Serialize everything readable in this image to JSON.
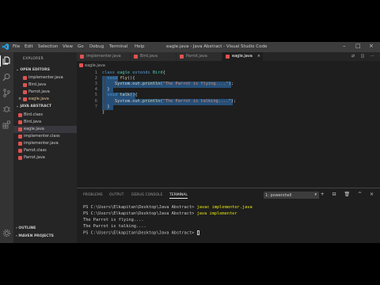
{
  "titlebar": {
    "menu": [
      "File",
      "Edit",
      "Selection",
      "View",
      "Go",
      "Debug",
      "Terminal",
      "Help"
    ],
    "title": "eagle.java - Java Abstract - Visual Studio Code"
  },
  "sidebar": {
    "explorer_title": "EXPLORER",
    "open_editors_title": "OPEN EDITORS",
    "open_editors": [
      {
        "name": "implementer.java",
        "modified": false,
        "close": false
      },
      {
        "name": "Bird.java",
        "modified": false,
        "close": false
      },
      {
        "name": "Parrot.java",
        "modified": false,
        "close": false
      },
      {
        "name": "eagle.java",
        "modified": true,
        "close": true
      }
    ],
    "project_title": "JAVA ABSTRACT",
    "files": [
      {
        "name": "Bird.class"
      },
      {
        "name": "Bird.java"
      },
      {
        "name": "eagle.java",
        "selected": true
      },
      {
        "name": "implementer.class"
      },
      {
        "name": "implementer.java"
      },
      {
        "name": "Parrot.class"
      },
      {
        "name": "Parrot.java"
      }
    ],
    "outline_title": "OUTLINE",
    "maven_title": "MAVEN PROJECTS"
  },
  "tabs": [
    {
      "label": "implementer.java",
      "active": false
    },
    {
      "label": "Bird.java",
      "active": false
    },
    {
      "label": "Parrot.java",
      "active": false
    },
    {
      "label": "eagle.java",
      "active": true
    }
  ],
  "breadcrumb": "eagle.java",
  "editor": {
    "line_numbers": [
      "1",
      "2",
      "3",
      "4",
      "5",
      "6",
      "7"
    ],
    "lines": {
      "l1_kw1": "class",
      "l1_cls": "eagle",
      "l1_kw2": "extends",
      "l1_cls2": "Bird",
      "l1_end": "{",
      "l2_kw": "void",
      "l2_fn": "fly",
      "l2_end": "(){",
      "l3_pre": "System.out.",
      "l3_fn": "println",
      "l3_str": "\"The Parrot is flying....\"",
      "l3_end": ");",
      "l4": "}",
      "l5_kw": "void",
      "l5_fn": "talk",
      "l5_end": "(){",
      "l6_pre": "System.out.",
      "l6_fn": "println",
      "l6_str": "\"The Parrot is talking....\"",
      "l6_end": ");",
      "l7": "}"
    },
    "line8": "}"
  },
  "panel": {
    "tabs": [
      "PROBLEMS",
      "OUTPUT",
      "DEBUG CONSOLE",
      "TERMINAL"
    ],
    "terminal_select": "1: powershell",
    "terminal": {
      "p1_prompt": "PS C:\\Users\\Elkapitan\\Desktop\\Java Abstract>",
      "p1_cmd": "javac implementer.java",
      "p2_prompt": "PS C:\\Users\\Elkapitan\\Desktop\\Java Abstract>",
      "p2_cmd": "java implementer",
      "out1": "The Parrot is flying....",
      "out2": "The Parrot is talking....",
      "p3_prompt": "PS C:\\Users\\Elkapitan\\Desktop\\Java Abstract>"
    }
  },
  "colors": {
    "accent": "#007acc",
    "java_icon": "#e05252",
    "selection": "#264f78",
    "keyword": "#569cd6"
  }
}
